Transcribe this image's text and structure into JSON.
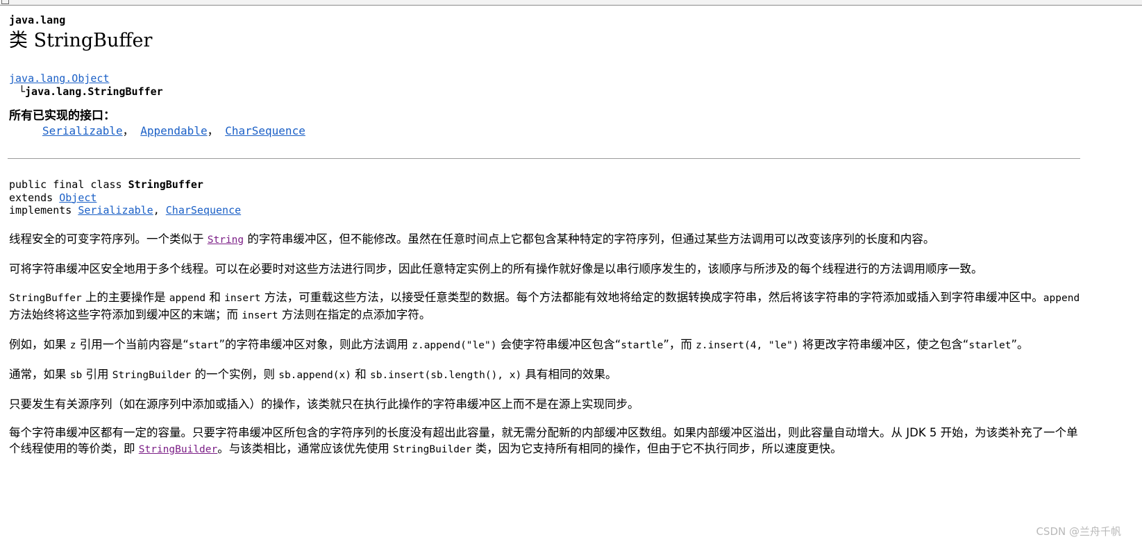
{
  "header": {
    "package": "java.lang",
    "class_title": "类 StringBuffer"
  },
  "inheritance": {
    "parent_link": "java.lang.Object",
    "child_prefix": "└",
    "child": "java.lang.StringBuffer"
  },
  "interfaces": {
    "label": "所有已实现的接口：",
    "items": [
      "Serializable",
      "Appendable",
      "CharSequence"
    ],
    "separator": "，"
  },
  "declaration": {
    "line1_prefix": "public final class ",
    "line1_name": "StringBuffer",
    "line2_prefix": "extends ",
    "line2_link": "Object",
    "line3_prefix": "implements ",
    "line3_link1": "Serializable",
    "line3_sep": ", ",
    "line3_link2": "CharSequence"
  },
  "description": {
    "p1_a": "线程安全的可变字符序列。一个类似于 ",
    "p1_link": "String",
    "p1_b": " 的字符串缓冲区，但不能修改。虽然在任意时间点上它都包含某种特定的字符序列，但通过某些方法调用可以改变该序列的长度和内容。",
    "p2": "可将字符串缓冲区安全地用于多个线程。可以在必要时对这些方法进行同步，因此任意特定实例上的所有操作就好像是以串行顺序发生的，该顺序与所涉及的每个线程进行的方法调用顺序一致。",
    "p3_code1": "StringBuffer",
    "p3_a": " 上的主要操作是 ",
    "p3_code2": "append",
    "p3_b": " 和 ",
    "p3_code3": "insert",
    "p3_c": " 方法，可重载这些方法，以接受任意类型的数据。每个方法都能有效地将给定的数据转换成字符串，然后将该字符串的字符添加或插入到字符串缓冲区中。",
    "p3_code4": "append",
    "p3_d": " 方法始终将这些字符添加到缓冲区的末端；而 ",
    "p3_code5": "insert",
    "p3_e": " 方法则在指定的点添加字符。",
    "p4_a": "例如，如果 ",
    "p4_code1": "z",
    "p4_b": " 引用一个当前内容是“",
    "p4_code2": "start",
    "p4_c": "”的字符串缓冲区对象，则此方法调用 ",
    "p4_code3": "z.append(\"le\")",
    "p4_d": " 会使字符串缓冲区包含“",
    "p4_code4": "startle",
    "p4_e": "”，而 ",
    "p4_code5": "z.insert(4, \"le\")",
    "p4_f": " 将更改字符串缓冲区，使之包含“",
    "p4_code6": "starlet",
    "p4_g": "”。",
    "p5_a": "通常，如果 ",
    "p5_code1": "sb",
    "p5_b": " 引用 ",
    "p5_code2": "StringBuilder",
    "p5_c": " 的一个实例，则 ",
    "p5_code3": "sb.append(x)",
    "p5_d": " 和 ",
    "p5_code4": "sb.insert(sb.length(), x)",
    "p5_e": " 具有相同的效果。",
    "p6": "只要发生有关源序列（如在源序列中添加或插入）的操作，该类就只在执行此操作的字符串缓冲区上而不是在源上实现同步。",
    "p7_a": "每个字符串缓冲区都有一定的容量。只要字符串缓冲区所包含的字符序列的长度没有超出此容量，就无需分配新的内部缓冲区数组。如果内部缓冲区溢出，则此容量自动增大。从 JDK 5 开始，为该类补充了一个单个线程使用的等价类，即 ",
    "p7_link": "StringBuilder",
    "p7_b": "。与该类相比，通常应该优先使用 ",
    "p7_code1": "StringBuilder",
    "p7_c": " 类，因为它支持所有相同的操作，但由于它不执行同步，所以速度更快。"
  },
  "watermark": "CSDN @兰舟千帆",
  "colors": {
    "link": "#1a5fc6",
    "visited_link": "#7b1e86"
  }
}
